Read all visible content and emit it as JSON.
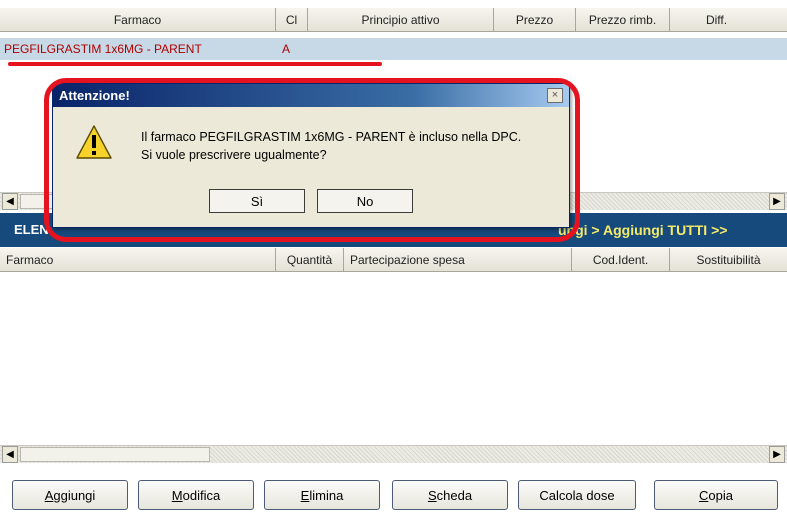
{
  "top_table": {
    "columns": [
      "Farmaco",
      "Cl",
      "Principio attivo",
      "Prezzo",
      "Prezzo rimb.",
      "Diff."
    ],
    "selected_row": {
      "farmaco": "PEGFILGRASTIM 1x6MG - PARENT",
      "cl": "A"
    }
  },
  "elenco_bar": {
    "label": "ELEN",
    "links_text": "ungi >  Aggiungi TUTTI >>"
  },
  "bottom_table": {
    "columns": [
      "Farmaco",
      "Quantità",
      "Partecipazione spesa",
      "Cod.Ident.",
      "Sostituibilità"
    ]
  },
  "dialog": {
    "title": "Attenzione!",
    "close": "×",
    "message_line1": "Il farmaco PEGFILGRASTIM 1x6MG - PARENT è incluso nella DPC.",
    "message_line2": "Si vuole prescrivere ugualmente?",
    "yes_label": "Sì",
    "no_label": "No"
  },
  "buttons": {
    "aggiungi": {
      "u": "A",
      "rest": "ggiungi"
    },
    "modifica": {
      "u": "M",
      "rest": "odifica"
    },
    "elimina": {
      "u": "E",
      "rest": "limina"
    },
    "scheda": {
      "u": "S",
      "rest": "cheda"
    },
    "calcola_dose": "Calcola dose",
    "copia": {
      "u": "C",
      "rest": "opia"
    }
  },
  "scroll_arrows": {
    "left": "◀",
    "right": "▶"
  },
  "colors": {
    "accent_bar": "#16497c",
    "link_yellow": "#f4ea6a",
    "selected_row_bg": "#c7d9e6",
    "selected_text": "#b00000",
    "annotation_red": "#e5131f"
  }
}
